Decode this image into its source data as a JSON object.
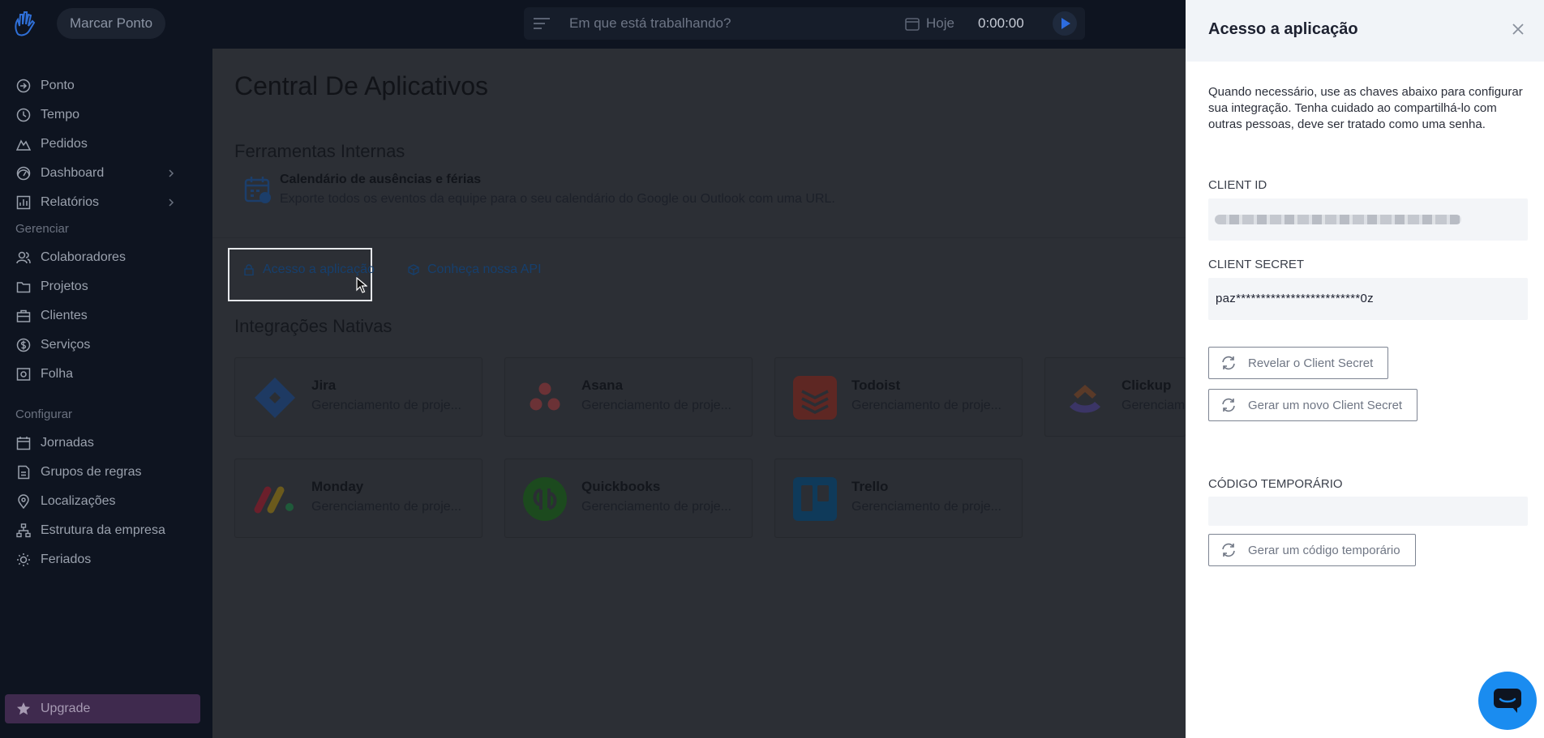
{
  "topbar": {
    "punch_label": "Marcar Ponto",
    "task_placeholder": "Em que está trabalhando?",
    "date_label": "Hoje",
    "timer": "0:00:00",
    "icons": [
      "logo-icon",
      "menu-icon",
      "calendar-icon",
      "play-icon"
    ]
  },
  "sidebar": {
    "items": [
      {
        "label": "Ponto",
        "icon": "clock-in-icon"
      },
      {
        "label": "Tempo",
        "icon": "clock-icon"
      },
      {
        "label": "Pedidos",
        "icon": "mountain-icon"
      },
      {
        "label": "Dashboard",
        "icon": "dashboard-icon",
        "has_chevron": true
      },
      {
        "label": "Relatórios",
        "icon": "reports-icon",
        "has_chevron": true
      }
    ],
    "manage_title": "Gerenciar",
    "manage_items": [
      {
        "label": "Colaboradores",
        "icon": "users-icon"
      },
      {
        "label": "Projetos",
        "icon": "folder-icon"
      },
      {
        "label": "Clientes",
        "icon": "briefcase-icon"
      },
      {
        "label": "Serviços",
        "icon": "dollar-icon"
      },
      {
        "label": "Folha",
        "icon": "payroll-icon"
      }
    ],
    "config_title": "Configurar",
    "config_items": [
      {
        "label": "Jornadas",
        "icon": "calendar-icon"
      },
      {
        "label": "Grupos de regras",
        "icon": "rules-icon"
      },
      {
        "label": "Localizações",
        "icon": "location-icon"
      },
      {
        "label": "Estrutura da empresa",
        "icon": "org-icon"
      },
      {
        "label": "Feriados",
        "icon": "sun-icon"
      }
    ],
    "upgrade_label": "Upgrade"
  },
  "main": {
    "title": "Central De Aplicativos",
    "internal_tools_title": "Ferramentas Internas",
    "tool": {
      "name": "Calendário de ausências e férias",
      "description": "Exporte todos os eventos da equipe para o seu calendário do Google ou Outlook com uma URL."
    },
    "links": {
      "app_access": "Acesso a aplicação",
      "api": "Conheça nossa API"
    },
    "native_title": "Integrações Nativas",
    "integrations": [
      {
        "name": "Jira",
        "desc": "Gerenciamento de proje...",
        "color": "#2684ff"
      },
      {
        "name": "Asana",
        "desc": "Gerenciamento de proje...",
        "color": "#f06a6a"
      },
      {
        "name": "Todoist",
        "desc": "Gerenciamento de proje...",
        "color": "#db4c3f"
      },
      {
        "name": "Clickup",
        "desc": "Gerenciam",
        "color": "#7b68ee"
      },
      {
        "name": "Monday",
        "desc": "Gerenciamento de proje...",
        "color": "#ff3d57"
      },
      {
        "name": "Quickbooks",
        "desc": "Gerenciamento de proje...",
        "color": "#2ca01c"
      },
      {
        "name": "Trello",
        "desc": "Gerenciamento de proje...",
        "color": "#0079bf"
      }
    ]
  },
  "drawer": {
    "title": "Acesso a aplicação",
    "description": "Quando necessário, use as chaves abaixo para configurar sua integração. Tenha cuidado ao compartilhá-lo com outras pessoas, deve ser tratado como uma senha.",
    "client_id_label": "CLIENT ID",
    "client_secret_label": "CLIENT SECRET",
    "client_secret_value": "paz*************************0z",
    "reveal_button": "Revelar o Client Secret",
    "new_secret_button": "Gerar um novo Client Secret",
    "temp_code_label": "CÓDIGO TEMPORÁRIO",
    "temp_code_value": "",
    "temp_code_button": "Gerar um código temporário"
  },
  "colors": {
    "accent": "#1a8cf0",
    "upgrade": "#6b2fa0"
  }
}
